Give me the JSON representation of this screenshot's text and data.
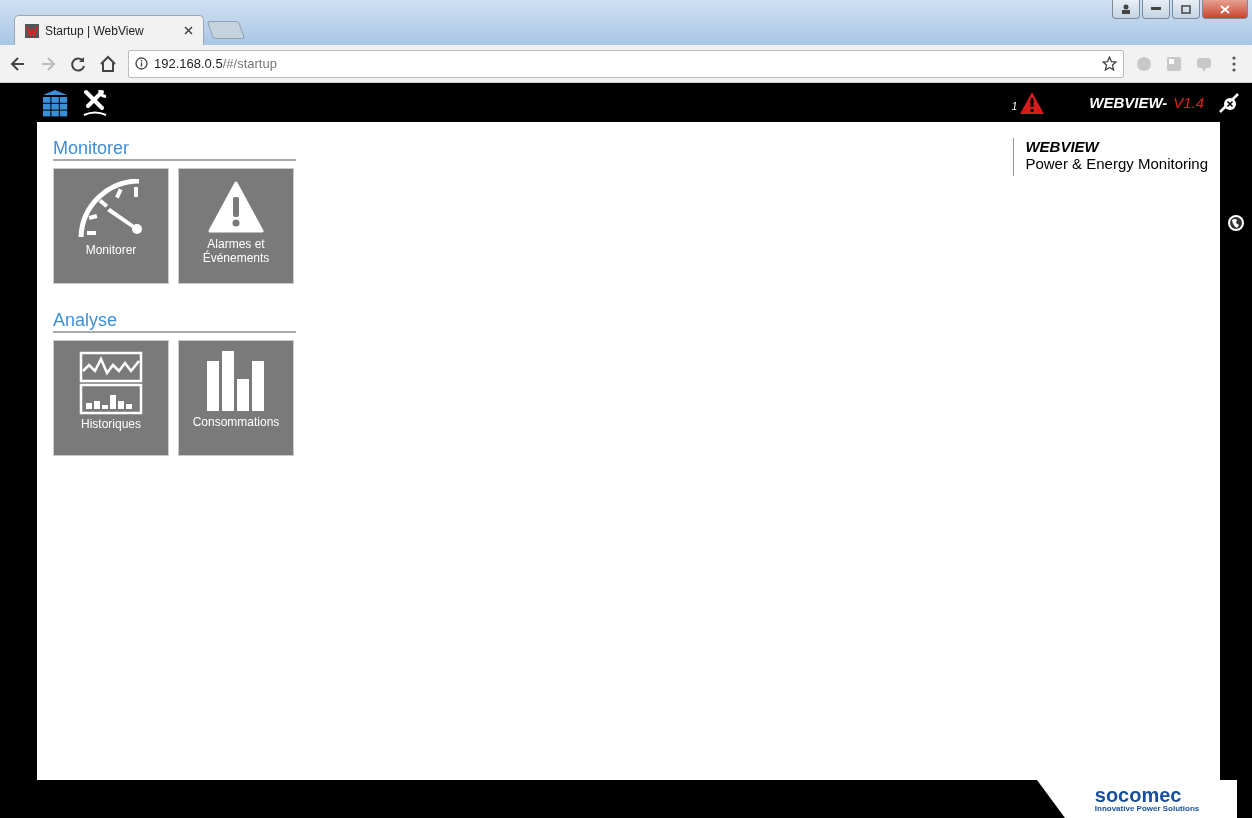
{
  "browser": {
    "tab_title": "Startup | WebView",
    "url_host": "192.168.0.5",
    "url_path": "/#/startup"
  },
  "header": {
    "alarm_count": "1",
    "brand": "WEBVIEW-",
    "version": "V1.4"
  },
  "sections": [
    {
      "title": "Monitorer",
      "tiles": [
        {
          "kind": "gauge",
          "label": "Monitorer"
        },
        {
          "kind": "alarm",
          "label": "Alarmes et Événements"
        }
      ]
    },
    {
      "title": "Analyse",
      "tiles": [
        {
          "kind": "history",
          "label": "Historiques"
        },
        {
          "kind": "bars",
          "label": "Consommations"
        }
      ]
    }
  ],
  "product": {
    "name": "WEBVIEW",
    "subtitle": "Power & Energy Monitoring"
  },
  "footer": {
    "logo": "socomec",
    "tagline": "Innovative Power Solutions"
  }
}
